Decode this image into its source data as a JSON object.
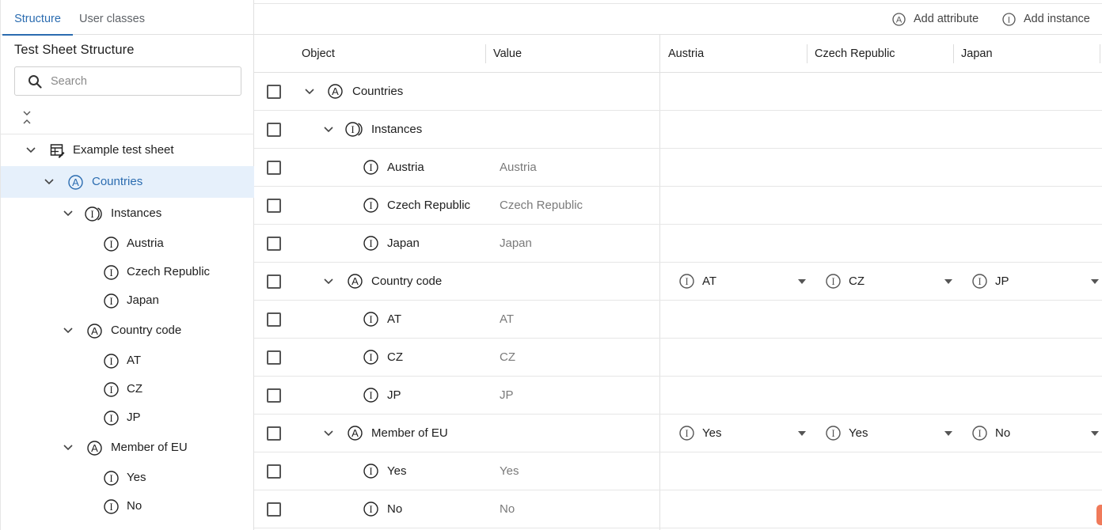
{
  "tabs": {
    "structure": "Structure",
    "user_classes": "User classes"
  },
  "left": {
    "title": "Test Sheet Structure",
    "search_placeholder": "Search",
    "tree": [
      {
        "label": "Example test sheet",
        "icon": "table-edit-icon"
      },
      {
        "label": "Countries",
        "icon": "attribute-icon",
        "selected": true
      },
      {
        "label": "Instances",
        "icon": "instances-icon"
      },
      {
        "label": "Austria",
        "icon": "instance-icon"
      },
      {
        "label": "Czech Republic",
        "icon": "instance-icon"
      },
      {
        "label": "Japan",
        "icon": "instance-icon"
      },
      {
        "label": "Country code",
        "icon": "attribute-icon"
      },
      {
        "label": "AT",
        "icon": "instance-icon"
      },
      {
        "label": "CZ",
        "icon": "instance-icon"
      },
      {
        "label": "JP",
        "icon": "instance-icon"
      },
      {
        "label": "Member of EU",
        "icon": "attribute-icon"
      },
      {
        "label": "Yes",
        "icon": "instance-icon"
      },
      {
        "label": "No",
        "icon": "instance-icon"
      }
    ]
  },
  "toolbar": {
    "add_attribute": "Add attribute",
    "add_instance": "Add instance"
  },
  "grid": {
    "headers": {
      "object": "Object",
      "value": "Value",
      "austria": "Austria",
      "czech": "Czech Republic",
      "japan": "Japan"
    },
    "rows": [
      {
        "object": "Countries",
        "value": "",
        "icon": "attribute-icon"
      },
      {
        "object": "Instances",
        "value": "",
        "icon": "instances-icon"
      },
      {
        "object": "Austria",
        "value": "Austria",
        "icon": "instance-icon"
      },
      {
        "object": "Czech Republic",
        "value": "Czech Republic",
        "icon": "instance-icon"
      },
      {
        "object": "Japan",
        "value": "Japan",
        "icon": "instance-icon"
      },
      {
        "object": "Country code",
        "value": "",
        "icon": "attribute-icon",
        "cells": {
          "austria": "AT",
          "czech": "CZ",
          "japan": "JP"
        }
      },
      {
        "object": "AT",
        "value": "AT",
        "icon": "instance-icon"
      },
      {
        "object": "CZ",
        "value": "CZ",
        "icon": "instance-icon"
      },
      {
        "object": "JP",
        "value": "JP",
        "icon": "instance-icon"
      },
      {
        "object": "Member of EU",
        "value": "",
        "icon": "attribute-icon",
        "cells": {
          "austria": "Yes",
          "czech": "Yes",
          "japan": "No"
        }
      },
      {
        "object": "Yes",
        "value": "Yes",
        "icon": "instance-icon"
      },
      {
        "object": "No",
        "value": "No",
        "icon": "instance-icon"
      }
    ]
  },
  "colors": {
    "accent": "#2b6cb0",
    "selected_bg": "#e6f0fb",
    "muted_text": "#7a7a7a"
  }
}
